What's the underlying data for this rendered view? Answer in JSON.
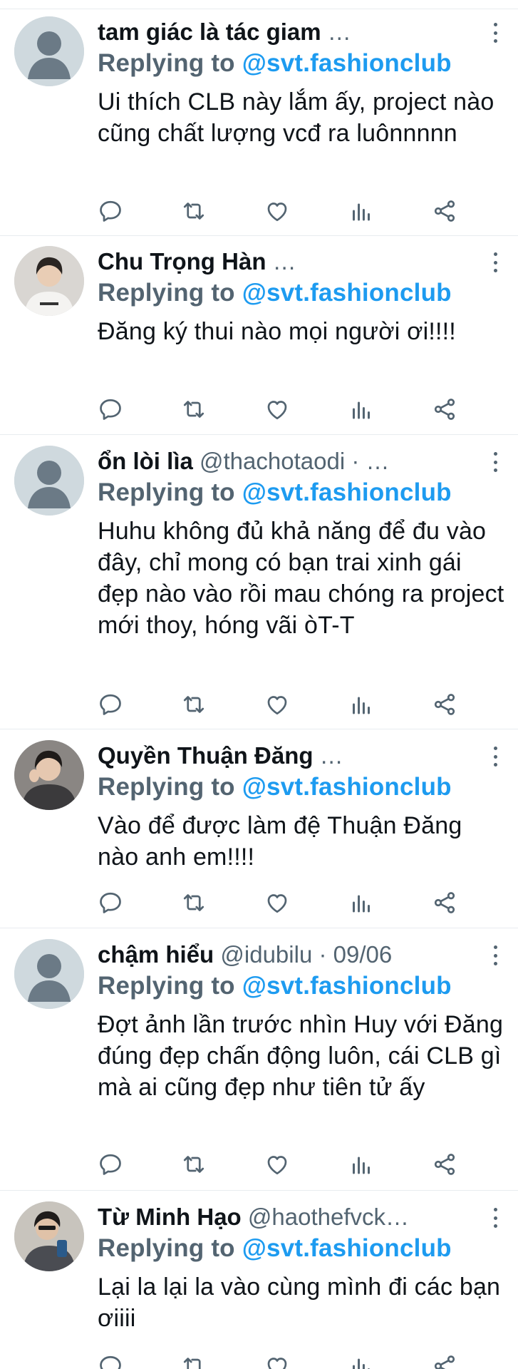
{
  "reply_prefix": "Replying to",
  "reply_mention": "@svt.fashionclub",
  "colors": {
    "accent": "#1d9bf0",
    "secondary_text": "#536471",
    "primary_text": "#0f1419",
    "divider": "#e8ecef"
  },
  "icons": {
    "reply": "comment-icon",
    "retweet": "retweet-icon",
    "like": "heart-icon",
    "stats": "stats-icon",
    "share": "share-icon",
    "more": "more-vertical-icon"
  },
  "tweets": [
    {
      "name": "tam giác là tác giam",
      "handle": "",
      "meta": " …",
      "avatar": "default",
      "text": "Ui thích CLB này lắm ấy, project nào cũng chất lượng vcđ ra luônnnnn"
    },
    {
      "name": "Chu Trọng Hàn",
      "handle": "",
      "meta": " …",
      "avatar": "photo-white-shirt",
      "text": "Đăng ký thui nào mọi người ơi!!!!"
    },
    {
      "name": "ổn lòi lìa",
      "handle": " @thachotaodi",
      "meta": " · …",
      "avatar": "default",
      "text": "Huhu không đủ khả năng để đu vào đây, chỉ mong có bạn trai xinh gái đẹp nào vào rồi mau chóng ra project mới thoy, hóng vãi òT-T"
    },
    {
      "name": "Quyền Thuận Đăng",
      "handle": "",
      "meta": " …",
      "avatar": "photo-dark-hoodie",
      "text": "Vào để được làm đệ Thuận Đăng nào anh em!!!!"
    },
    {
      "name": "chậm hiểu",
      "handle": " @idubilu",
      "meta": " · 09/06",
      "avatar": "default",
      "text": "Đợt ảnh lần trước nhìn Huy với Đăng đúng đẹp chấn động luôn, cái CLB gì mà ai cũng đẹp như tiên tử ấy"
    },
    {
      "name": "Từ Minh Hạo",
      "handle": " @haothefvck…",
      "meta": "",
      "avatar": "photo-mirror-selfie",
      "text": "Lại la lại la vào cùng mình đi các bạn ơiiii"
    }
  ]
}
